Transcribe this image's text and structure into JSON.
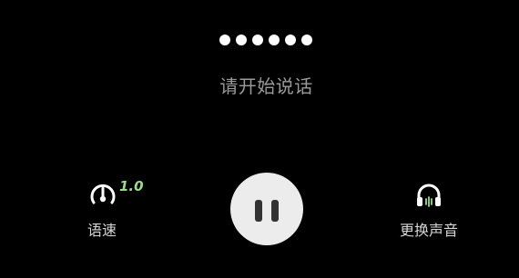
{
  "recording": {
    "prompt": "请开始说话",
    "indicator_dots": 6
  },
  "speed": {
    "icon": "speedometer-icon",
    "value": "1.0",
    "label": "语速"
  },
  "pause_button": {
    "icon": "pause-icon"
  },
  "voice": {
    "icon": "headphones-icon",
    "label": "更换声音"
  },
  "colors": {
    "background": "#000000",
    "prompt_text": "#9a9a9a",
    "speed_value": "#9bdb8c",
    "accent_bars": "#9bdb8c",
    "button_bg": "#ececec"
  }
}
